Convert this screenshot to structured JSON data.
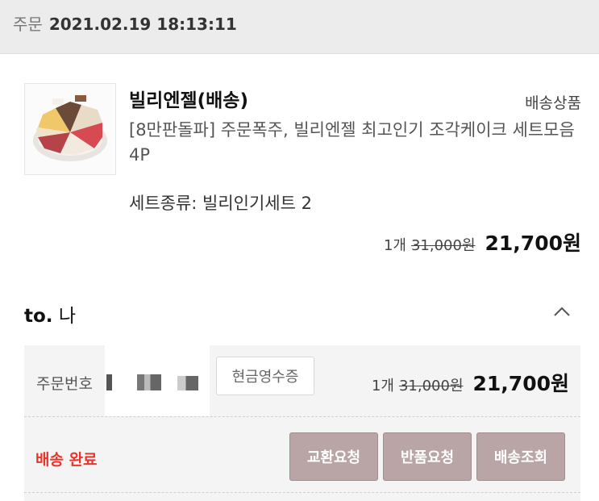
{
  "order_header": {
    "label": "주문",
    "datetime": "2021.02.19 18:13:11"
  },
  "product": {
    "store": "빌리엔젤(배송)",
    "ship_type": "배송상품",
    "name": "[8만판돌파] 주문폭주, 빌리엔젤 최고인기 조각케이크 세트모음 4P",
    "option": "세트종류: 빌리인기세트 2",
    "qty": "1개",
    "original_price": "31,000원",
    "final_price": "21,700원"
  },
  "recipient": {
    "to": "to.",
    "name": "나"
  },
  "order": {
    "number_label": "주문번호",
    "receipt_button": "현금영수증",
    "qty": "1개",
    "original_price": "31,000원",
    "final_price": "21,700원",
    "status": "배송 완료",
    "actions": [
      "교환요청",
      "반품요청",
      "배송조회"
    ]
  },
  "colors": {
    "status": "#e8352b",
    "action_button": "#b9a5a6",
    "header_bg": "#ececec"
  }
}
